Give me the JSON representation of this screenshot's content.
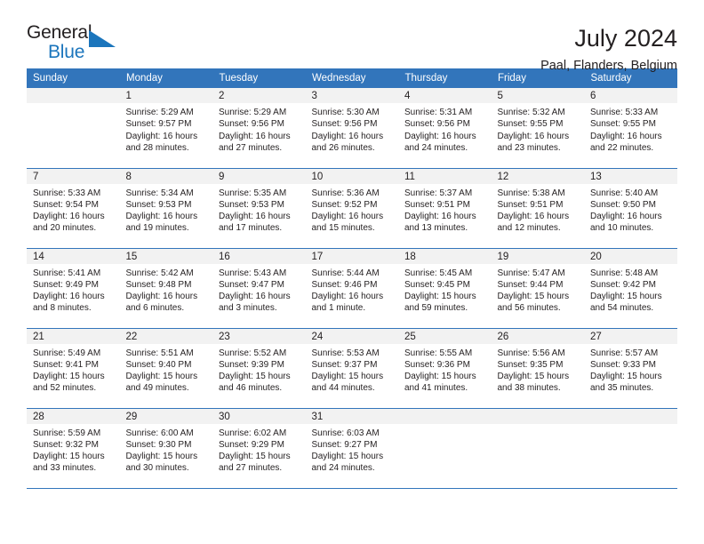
{
  "brand": {
    "name_part1": "General",
    "name_part2": "Blue",
    "accent_color": "#1b75bc"
  },
  "header": {
    "title": "July 2024",
    "subtitle": "Paal, Flanders, Belgium"
  },
  "theme": {
    "header_band_color": "#3275bb",
    "date_strip_color": "#f2f2f2",
    "text_color": "#231f20"
  },
  "weekday_headers": [
    "Sunday",
    "Monday",
    "Tuesday",
    "Wednesday",
    "Thursday",
    "Friday",
    "Saturday"
  ],
  "weeks": [
    [
      {
        "date": "",
        "empty": true
      },
      {
        "date": "1",
        "sunrise": "Sunrise: 5:29 AM",
        "sunset": "Sunset: 9:57 PM",
        "daylight": "Daylight: 16 hours and 28 minutes."
      },
      {
        "date": "2",
        "sunrise": "Sunrise: 5:29 AM",
        "sunset": "Sunset: 9:56 PM",
        "daylight": "Daylight: 16 hours and 27 minutes."
      },
      {
        "date": "3",
        "sunrise": "Sunrise: 5:30 AM",
        "sunset": "Sunset: 9:56 PM",
        "daylight": "Daylight: 16 hours and 26 minutes."
      },
      {
        "date": "4",
        "sunrise": "Sunrise: 5:31 AM",
        "sunset": "Sunset: 9:56 PM",
        "daylight": "Daylight: 16 hours and 24 minutes."
      },
      {
        "date": "5",
        "sunrise": "Sunrise: 5:32 AM",
        "sunset": "Sunset: 9:55 PM",
        "daylight": "Daylight: 16 hours and 23 minutes."
      },
      {
        "date": "6",
        "sunrise": "Sunrise: 5:33 AM",
        "sunset": "Sunset: 9:55 PM",
        "daylight": "Daylight: 16 hours and 22 minutes."
      }
    ],
    [
      {
        "date": "7",
        "sunrise": "Sunrise: 5:33 AM",
        "sunset": "Sunset: 9:54 PM",
        "daylight": "Daylight: 16 hours and 20 minutes."
      },
      {
        "date": "8",
        "sunrise": "Sunrise: 5:34 AM",
        "sunset": "Sunset: 9:53 PM",
        "daylight": "Daylight: 16 hours and 19 minutes."
      },
      {
        "date": "9",
        "sunrise": "Sunrise: 5:35 AM",
        "sunset": "Sunset: 9:53 PM",
        "daylight": "Daylight: 16 hours and 17 minutes."
      },
      {
        "date": "10",
        "sunrise": "Sunrise: 5:36 AM",
        "sunset": "Sunset: 9:52 PM",
        "daylight": "Daylight: 16 hours and 15 minutes."
      },
      {
        "date": "11",
        "sunrise": "Sunrise: 5:37 AM",
        "sunset": "Sunset: 9:51 PM",
        "daylight": "Daylight: 16 hours and 13 minutes."
      },
      {
        "date": "12",
        "sunrise": "Sunrise: 5:38 AM",
        "sunset": "Sunset: 9:51 PM",
        "daylight": "Daylight: 16 hours and 12 minutes."
      },
      {
        "date": "13",
        "sunrise": "Sunrise: 5:40 AM",
        "sunset": "Sunset: 9:50 PM",
        "daylight": "Daylight: 16 hours and 10 minutes."
      }
    ],
    [
      {
        "date": "14",
        "sunrise": "Sunrise: 5:41 AM",
        "sunset": "Sunset: 9:49 PM",
        "daylight": "Daylight: 16 hours and 8 minutes."
      },
      {
        "date": "15",
        "sunrise": "Sunrise: 5:42 AM",
        "sunset": "Sunset: 9:48 PM",
        "daylight": "Daylight: 16 hours and 6 minutes."
      },
      {
        "date": "16",
        "sunrise": "Sunrise: 5:43 AM",
        "sunset": "Sunset: 9:47 PM",
        "daylight": "Daylight: 16 hours and 3 minutes."
      },
      {
        "date": "17",
        "sunrise": "Sunrise: 5:44 AM",
        "sunset": "Sunset: 9:46 PM",
        "daylight": "Daylight: 16 hours and 1 minute."
      },
      {
        "date": "18",
        "sunrise": "Sunrise: 5:45 AM",
        "sunset": "Sunset: 9:45 PM",
        "daylight": "Daylight: 15 hours and 59 minutes."
      },
      {
        "date": "19",
        "sunrise": "Sunrise: 5:47 AM",
        "sunset": "Sunset: 9:44 PM",
        "daylight": "Daylight: 15 hours and 56 minutes."
      },
      {
        "date": "20",
        "sunrise": "Sunrise: 5:48 AM",
        "sunset": "Sunset: 9:42 PM",
        "daylight": "Daylight: 15 hours and 54 minutes."
      }
    ],
    [
      {
        "date": "21",
        "sunrise": "Sunrise: 5:49 AM",
        "sunset": "Sunset: 9:41 PM",
        "daylight": "Daylight: 15 hours and 52 minutes."
      },
      {
        "date": "22",
        "sunrise": "Sunrise: 5:51 AM",
        "sunset": "Sunset: 9:40 PM",
        "daylight": "Daylight: 15 hours and 49 minutes."
      },
      {
        "date": "23",
        "sunrise": "Sunrise: 5:52 AM",
        "sunset": "Sunset: 9:39 PM",
        "daylight": "Daylight: 15 hours and 46 minutes."
      },
      {
        "date": "24",
        "sunrise": "Sunrise: 5:53 AM",
        "sunset": "Sunset: 9:37 PM",
        "daylight": "Daylight: 15 hours and 44 minutes."
      },
      {
        "date": "25",
        "sunrise": "Sunrise: 5:55 AM",
        "sunset": "Sunset: 9:36 PM",
        "daylight": "Daylight: 15 hours and 41 minutes."
      },
      {
        "date": "26",
        "sunrise": "Sunrise: 5:56 AM",
        "sunset": "Sunset: 9:35 PM",
        "daylight": "Daylight: 15 hours and 38 minutes."
      },
      {
        "date": "27",
        "sunrise": "Sunrise: 5:57 AM",
        "sunset": "Sunset: 9:33 PM",
        "daylight": "Daylight: 15 hours and 35 minutes."
      }
    ],
    [
      {
        "date": "28",
        "sunrise": "Sunrise: 5:59 AM",
        "sunset": "Sunset: 9:32 PM",
        "daylight": "Daylight: 15 hours and 33 minutes."
      },
      {
        "date": "29",
        "sunrise": "Sunrise: 6:00 AM",
        "sunset": "Sunset: 9:30 PM",
        "daylight": "Daylight: 15 hours and 30 minutes."
      },
      {
        "date": "30",
        "sunrise": "Sunrise: 6:02 AM",
        "sunset": "Sunset: 9:29 PM",
        "daylight": "Daylight: 15 hours and 27 minutes."
      },
      {
        "date": "31",
        "sunrise": "Sunrise: 6:03 AM",
        "sunset": "Sunset: 9:27 PM",
        "daylight": "Daylight: 15 hours and 24 minutes."
      },
      {
        "date": "",
        "empty": true
      },
      {
        "date": "",
        "empty": true
      },
      {
        "date": "",
        "empty": true
      }
    ]
  ]
}
